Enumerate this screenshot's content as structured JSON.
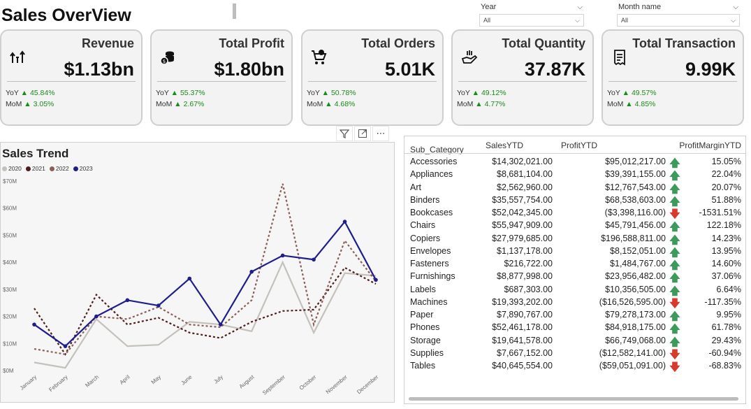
{
  "page": {
    "title": "Sales OverView"
  },
  "slicers": [
    {
      "label": "Year",
      "value": "All"
    },
    {
      "label": "Month name",
      "value": "All"
    }
  ],
  "kpis": [
    {
      "title": "Revenue",
      "value": "$1.13bn",
      "yoy": "45.84%",
      "mom": "3.05%",
      "icon": "revenue-icon"
    },
    {
      "title": "Total Profit",
      "value": "$1.80bn",
      "yoy": "55.37%",
      "mom": "2.67%",
      "icon": "coins-icon"
    },
    {
      "title": "Total Orders",
      "value": "5.01K",
      "yoy": "50.78%",
      "mom": "4.68%",
      "icon": "cart-icon"
    },
    {
      "title": "Total Quantity",
      "value": "37.87K",
      "yoy": "49.12%",
      "mom": "4.77%",
      "icon": "hand-package-icon"
    },
    {
      "title": "Total Transaction",
      "value": "9.99K",
      "yoy": "49.57%",
      "mom": "4.85%",
      "icon": "receipt-icon"
    }
  ],
  "kpi_labels": {
    "yoy": "YoY",
    "mom": "MoM",
    "up_arrow": "▲"
  },
  "chart_data": {
    "type": "line",
    "title": "Sales Trend",
    "categories": [
      "January",
      "February",
      "March",
      "April",
      "May",
      "June",
      "July",
      "August",
      "September",
      "October",
      "November",
      "December"
    ],
    "y_ticks": [
      "$0M",
      "$10M",
      "$20M",
      "$30M",
      "$40M",
      "$50M",
      "$60M",
      "$70M"
    ],
    "ylim": [
      0,
      70
    ],
    "legend_position": "top-left",
    "series": [
      {
        "name": "2020",
        "color": "#c4c1bc",
        "style": "solid",
        "markers": false,
        "values": [
          3,
          1,
          19,
          9,
          9.5,
          18,
          17,
          14.5,
          40,
          14,
          36,
          35
        ]
      },
      {
        "name": "2021",
        "color": "#4e1e1c",
        "style": "dashed",
        "markers": false,
        "values": [
          23,
          6,
          28,
          17,
          19.5,
          14,
          12,
          18,
          22,
          22.5,
          38,
          32
        ]
      },
      {
        "name": "2022",
        "color": "#8a5f55",
        "style": "dashed",
        "markers": false,
        "values": [
          8,
          6,
          20,
          19,
          23.5,
          17,
          16,
          26,
          69,
          17,
          48,
          33
        ]
      },
      {
        "name": "2023",
        "color": "#1e1f8c",
        "style": "solid",
        "markers": true,
        "values": [
          17,
          9,
          20,
          26,
          24,
          34,
          17,
          36.5,
          42.5,
          41,
          55,
          33.5
        ]
      }
    ]
  },
  "table": {
    "headers": {
      "category": "Sub_Category",
      "sales": "SalesYTD",
      "profit": "ProfitYTD",
      "margin": "ProfitMarginYTD"
    },
    "rows": [
      {
        "category": "Accessories",
        "sales": "$14,302,021.00",
        "profit": "$95,012,217.00",
        "trend": "up",
        "margin": "15.05%"
      },
      {
        "category": "Appliances",
        "sales": "$8,681,104.00",
        "profit": "$39,391,155.00",
        "trend": "up",
        "margin": "22.04%"
      },
      {
        "category": "Art",
        "sales": "$2,562,960.00",
        "profit": "$12,767,543.00",
        "trend": "up",
        "margin": "20.07%"
      },
      {
        "category": "Binders",
        "sales": "$35,557,754.00",
        "profit": "$68,538,603.00",
        "trend": "up",
        "margin": "51.88%"
      },
      {
        "category": "Bookcases",
        "sales": "$52,042,345.00",
        "profit": "($3,398,116.00)",
        "trend": "down",
        "margin": "-1531.51%"
      },
      {
        "category": "Chairs",
        "sales": "$55,947,909.00",
        "profit": "$45,791,456.00",
        "trend": "up",
        "margin": "122.18%"
      },
      {
        "category": "Copiers",
        "sales": "$27,979,685.00",
        "profit": "$196,588,811.00",
        "trend": "up",
        "margin": "14.23%"
      },
      {
        "category": "Envelopes",
        "sales": "$1,137,178.00",
        "profit": "$8,152,051.00",
        "trend": "up",
        "margin": "13.95%"
      },
      {
        "category": "Fasteners",
        "sales": "$216,722.00",
        "profit": "$1,484,767.00",
        "trend": "up",
        "margin": "14.60%"
      },
      {
        "category": "Furnishings",
        "sales": "$8,877,998.00",
        "profit": "$23,956,482.00",
        "trend": "up",
        "margin": "37.06%"
      },
      {
        "category": "Labels",
        "sales": "$687,303.00",
        "profit": "$10,356,505.00",
        "trend": "up",
        "margin": "6.64%"
      },
      {
        "category": "Machines",
        "sales": "$19,393,202.00",
        "profit": "($16,526,595.00)",
        "trend": "down",
        "margin": "-117.35%"
      },
      {
        "category": "Paper",
        "sales": "$7,890,767.00",
        "profit": "$79,278,173.00",
        "trend": "up",
        "margin": "9.95%"
      },
      {
        "category": "Phones",
        "sales": "$52,461,178.00",
        "profit": "$84,918,175.00",
        "trend": "up",
        "margin": "61.78%"
      },
      {
        "category": "Storage",
        "sales": "$19,641,578.00",
        "profit": "$66,749,068.00",
        "trend": "up",
        "margin": "29.43%"
      },
      {
        "category": "Supplies",
        "sales": "$7,667,152.00",
        "profit": "($12,582,141.00)",
        "trend": "down",
        "margin": "-60.94%"
      },
      {
        "category": "Tables",
        "sales": "$40,645,554.00",
        "profit": "($59,051,091.00)",
        "trend": "down",
        "margin": "-68.83%"
      }
    ]
  },
  "colors": {
    "up": "#1a8a1a",
    "arrow_up": "#3d9a5c",
    "arrow_down": "#d53a2c"
  }
}
